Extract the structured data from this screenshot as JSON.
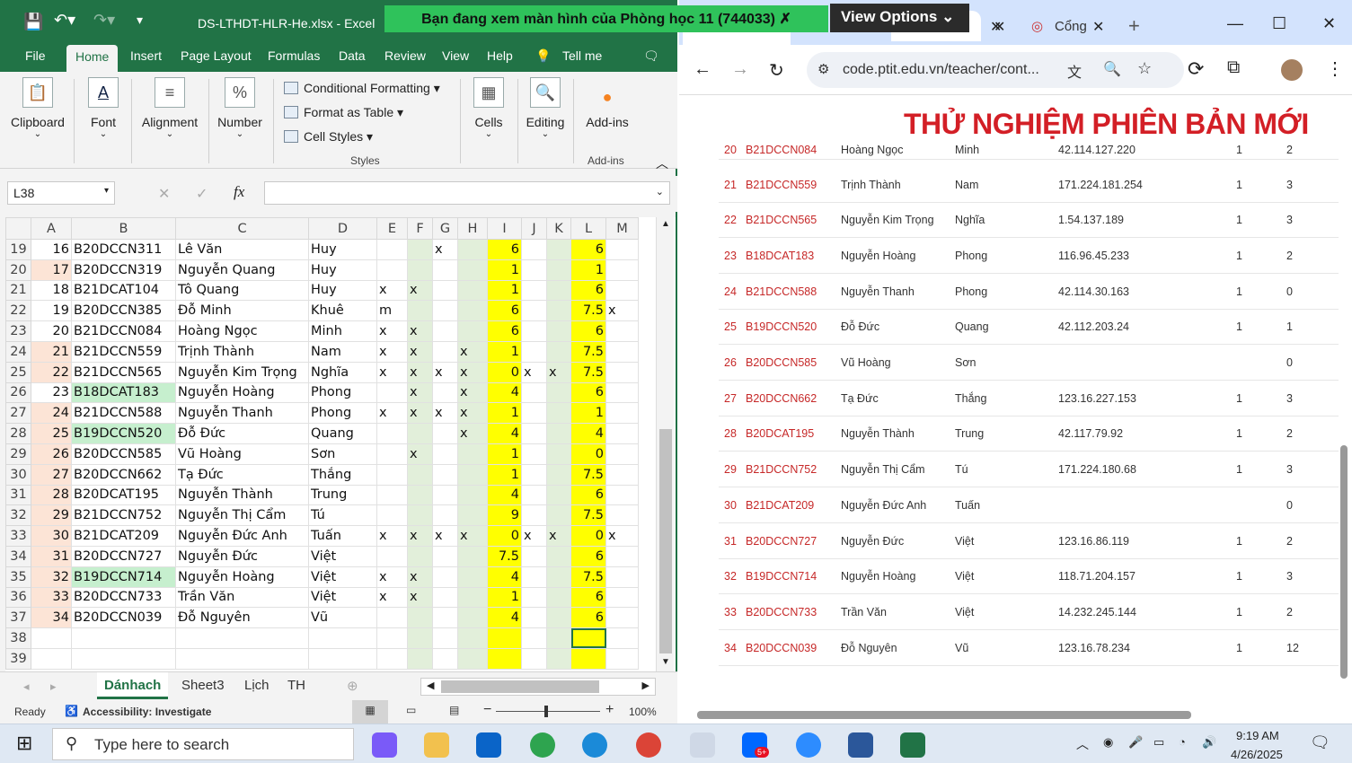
{
  "excel": {
    "title": "DS-LTHDT-HLR-He.xlsx  -  Excel",
    "tabs": [
      "File",
      "Home",
      "Insert",
      "Page Layout",
      "Formulas",
      "Data",
      "Review",
      "View",
      "Help",
      "Tell me"
    ],
    "ribbon": {
      "clipboard": "Clipboard",
      "font": "Font",
      "alignment": "Alignment",
      "number": "Number",
      "conditional_formatting": "Conditional Formatting",
      "format_as_table": "Format as Table",
      "cell_styles": "Cell Styles",
      "styles": "Styles",
      "cells": "Cells",
      "editing": "Editing",
      "addins": "Add-ins",
      "addins_group": "Add-ins"
    },
    "name_box": "L38",
    "fx": "fx",
    "columns": [
      "A",
      "B",
      "C",
      "D",
      "E",
      "F",
      "G",
      "H",
      "I",
      "J",
      "K",
      "L",
      "M"
    ],
    "rows": [
      {
        "r": "19",
        "a": "16",
        "b": "B20DCCN311",
        "c": "Lê Văn",
        "d": "Huy",
        "e": "",
        "f": "",
        "g": "x",
        "h": "",
        "i": "6",
        "j": "",
        "k": "",
        "l": "6",
        "m": ""
      },
      {
        "r": "20",
        "a": "17",
        "b": "B20DCCN319",
        "c": "Nguyễn Quang",
        "d": "Huy",
        "e": "",
        "f": "",
        "g": "",
        "h": "",
        "i": "1",
        "j": "",
        "k": "",
        "l": "1",
        "m": ""
      },
      {
        "r": "21",
        "a": "18",
        "b": "B21DCAT104",
        "c": "Tô Quang",
        "d": "Huy",
        "e": "x",
        "f": "x",
        "g": "",
        "h": "",
        "i": "1",
        "j": "",
        "k": "",
        "l": "6",
        "m": ""
      },
      {
        "r": "22",
        "a": "19",
        "b": "B20DCCN385",
        "c": "Đỗ Minh",
        "d": "Khuê",
        "e": "m",
        "f": "",
        "g": "",
        "h": "",
        "i": "6",
        "j": "",
        "k": "",
        "l": "7.5",
        "m": "x"
      },
      {
        "r": "23",
        "a": "20",
        "b": "B21DCCN084",
        "c": "Hoàng Ngọc",
        "d": "Minh",
        "e": "x",
        "f": "x",
        "g": "",
        "h": "",
        "i": "6",
        "j": "",
        "k": "",
        "l": "6",
        "m": ""
      },
      {
        "r": "24",
        "a": "21",
        "b": "B21DCCN559",
        "c": "Trịnh Thành",
        "d": "Nam",
        "e": "x",
        "f": "x",
        "g": "",
        "h": "x",
        "i": "1",
        "j": "",
        "k": "",
        "l": "7.5",
        "m": ""
      },
      {
        "r": "25",
        "a": "22",
        "b": "B21DCCN565",
        "c": "Nguyễn Kim Trọng",
        "d": "Nghĩa",
        "e": "x",
        "f": "x",
        "g": "x",
        "h": "x",
        "i": "0",
        "j": "x",
        "k": "x",
        "l": "7.5",
        "m": ""
      },
      {
        "r": "26",
        "a": "23",
        "b": "B18DCAT183",
        "c": "Nguyễn Hoàng",
        "d": "Phong",
        "e": "",
        "f": "x",
        "g": "",
        "h": "x",
        "i": "4",
        "j": "",
        "k": "",
        "l": "6",
        "m": ""
      },
      {
        "r": "27",
        "a": "24",
        "b": "B21DCCN588",
        "c": "Nguyễn Thanh",
        "d": "Phong",
        "e": "x",
        "f": "x",
        "g": "x",
        "h": "x",
        "i": "1",
        "j": "",
        "k": "",
        "l": "1",
        "m": ""
      },
      {
        "r": "28",
        "a": "25",
        "b": "B19DCCN520",
        "c": "Đỗ Đức",
        "d": "Quang",
        "e": "",
        "f": "",
        "g": "",
        "h": "x",
        "i": "4",
        "j": "",
        "k": "",
        "l": "4",
        "m": ""
      },
      {
        "r": "29",
        "a": "26",
        "b": "B20DCCN585",
        "c": "Vũ Hoàng",
        "d": "Sơn",
        "e": "",
        "f": "x",
        "g": "",
        "h": "",
        "i": "1",
        "j": "",
        "k": "",
        "l": "0",
        "m": ""
      },
      {
        "r": "30",
        "a": "27",
        "b": "B20DCCN662",
        "c": "Tạ Đức",
        "d": "Thắng",
        "e": "",
        "f": "",
        "g": "",
        "h": "",
        "i": "1",
        "j": "",
        "k": "",
        "l": "7.5",
        "m": ""
      },
      {
        "r": "31",
        "a": "28",
        "b": "B20DCAT195",
        "c": "Nguyễn Thành",
        "d": "Trung",
        "e": "",
        "f": "",
        "g": "",
        "h": "",
        "i": "4",
        "j": "",
        "k": "",
        "l": "6",
        "m": ""
      },
      {
        "r": "32",
        "a": "29",
        "b": "B21DCCN752",
        "c": "Nguyễn Thị Cẩm",
        "d": "Tú",
        "e": "",
        "f": "",
        "g": "",
        "h": "",
        "i": "9",
        "j": "",
        "k": "",
        "l": "7.5",
        "m": ""
      },
      {
        "r": "33",
        "a": "30",
        "b": "B21DCAT209",
        "c": "Nguyễn Đức Anh",
        "d": "Tuấn",
        "e": "x",
        "f": "x",
        "g": "x",
        "h": "x",
        "i": "0",
        "j": "x",
        "k": "x",
        "l": "0",
        "m": "x"
      },
      {
        "r": "34",
        "a": "31",
        "b": "B20DCCN727",
        "c": "Nguyễn Đức",
        "d": "Việt",
        "e": "",
        "f": "",
        "g": "",
        "h": "",
        "i": "7.5",
        "j": "",
        "k": "",
        "l": "6",
        "m": ""
      },
      {
        "r": "35",
        "a": "32",
        "b": "B19DCCN714",
        "c": "Nguyễn Hoàng",
        "d": "Việt",
        "e": "x",
        "f": "x",
        "g": "",
        "h": "",
        "i": "4",
        "j": "",
        "k": "",
        "l": "7.5",
        "m": ""
      },
      {
        "r": "36",
        "a": "33",
        "b": "B20DCCN733",
        "c": "Trần Văn",
        "d": "Việt",
        "e": "x",
        "f": "x",
        "g": "",
        "h": "",
        "i": "1",
        "j": "",
        "k": "",
        "l": "6",
        "m": ""
      },
      {
        "r": "37",
        "a": "34",
        "b": "B20DCCN039",
        "c": "Đỗ Nguyên",
        "d": "Vũ",
        "e": "",
        "f": "",
        "g": "",
        "h": "",
        "i": "4",
        "j": "",
        "k": "",
        "l": "6",
        "m": ""
      },
      {
        "r": "38",
        "a": "",
        "b": "",
        "c": "",
        "d": "",
        "e": "",
        "f": "",
        "g": "",
        "h": "",
        "i": "",
        "j": "",
        "k": "",
        "l": "",
        "m": ""
      },
      {
        "r": "39",
        "a": "",
        "b": "",
        "c": "",
        "d": "",
        "e": "",
        "f": "",
        "g": "",
        "h": "",
        "i": "",
        "j": "",
        "k": "",
        "l": "",
        "m": ""
      }
    ],
    "sheets": [
      "Dánhach",
      "Sheet3",
      "Lịch",
      "TH"
    ],
    "status": {
      "ready": "Ready",
      "accessibility": "Accessibility: Investigate",
      "zoom": "100%"
    }
  },
  "share_banner": "Bạn đang xem màn hình của  Phòng học 11 (744033)",
  "view_options": "View Options",
  "chrome": {
    "tab2": "Cổng",
    "url": "code.ptit.edu.vn/teacher/cont...",
    "banner": "THỬ NGHIỆM PHIÊN BẢN MỚI",
    "rows": [
      {
        "n": "20",
        "id": "B21DCCN084",
        "last": "Hoàng Ngọc",
        "first": "Minh",
        "ip": "42.114.127.220",
        "a": "1",
        "b": "2"
      },
      {
        "n": "21",
        "id": "B21DCCN559",
        "last": "Trịnh Thành",
        "first": "Nam",
        "ip": "171.224.181.254",
        "a": "1",
        "b": "3"
      },
      {
        "n": "22",
        "id": "B21DCCN565",
        "last": "Nguyễn Kim Trọng",
        "first": "Nghĩa",
        "ip": "1.54.137.189",
        "a": "1",
        "b": "3"
      },
      {
        "n": "23",
        "id": "B18DCAT183",
        "last": "Nguyễn Hoàng",
        "first": "Phong",
        "ip": "116.96.45.233",
        "a": "1",
        "b": "2"
      },
      {
        "n": "24",
        "id": "B21DCCN588",
        "last": "Nguyễn Thanh",
        "first": "Phong",
        "ip": "42.114.30.163",
        "a": "1",
        "b": "0"
      },
      {
        "n": "25",
        "id": "B19DCCN520",
        "last": "Đỗ Đức",
        "first": "Quang",
        "ip": "42.112.203.24",
        "a": "1",
        "b": "1"
      },
      {
        "n": "26",
        "id": "B20DCCN585",
        "last": "Vũ Hoàng",
        "first": "Sơn",
        "ip": "",
        "a": "",
        "b": "0"
      },
      {
        "n": "27",
        "id": "B20DCCN662",
        "last": "Tạ Đức",
        "first": "Thắng",
        "ip": "123.16.227.153",
        "a": "1",
        "b": "3"
      },
      {
        "n": "28",
        "id": "B20DCAT195",
        "last": "Nguyễn Thành",
        "first": "Trung",
        "ip": "42.117.79.92",
        "a": "1",
        "b": "2"
      },
      {
        "n": "29",
        "id": "B21DCCN752",
        "last": "Nguyễn Thị Cẩm",
        "first": "Tú",
        "ip": "171.224.180.68",
        "a": "1",
        "b": "3"
      },
      {
        "n": "30",
        "id": "B21DCAT209",
        "last": "Nguyễn Đức Anh",
        "first": "Tuấn",
        "ip": "",
        "a": "",
        "b": "0"
      },
      {
        "n": "31",
        "id": "B20DCCN727",
        "last": "Nguyễn Đức",
        "first": "Việt",
        "ip": "123.16.86.119",
        "a": "1",
        "b": "2"
      },
      {
        "n": "32",
        "id": "B19DCCN714",
        "last": "Nguyễn Hoàng",
        "first": "Việt",
        "ip": "118.71.204.157",
        "a": "1",
        "b": "3"
      },
      {
        "n": "33",
        "id": "B20DCCN733",
        "last": "Trần Văn",
        "first": "Việt",
        "ip": "14.232.245.144",
        "a": "1",
        "b": "2"
      },
      {
        "n": "34",
        "id": "B20DCCN039",
        "last": "Đỗ Nguyên",
        "first": "Vũ",
        "ip": "123.16.78.234",
        "a": "1",
        "b": "12"
      }
    ]
  },
  "taskbar": {
    "search": "Type here to search",
    "time": "9:19 AM",
    "date": "4/26/2025",
    "badge": "5+"
  }
}
